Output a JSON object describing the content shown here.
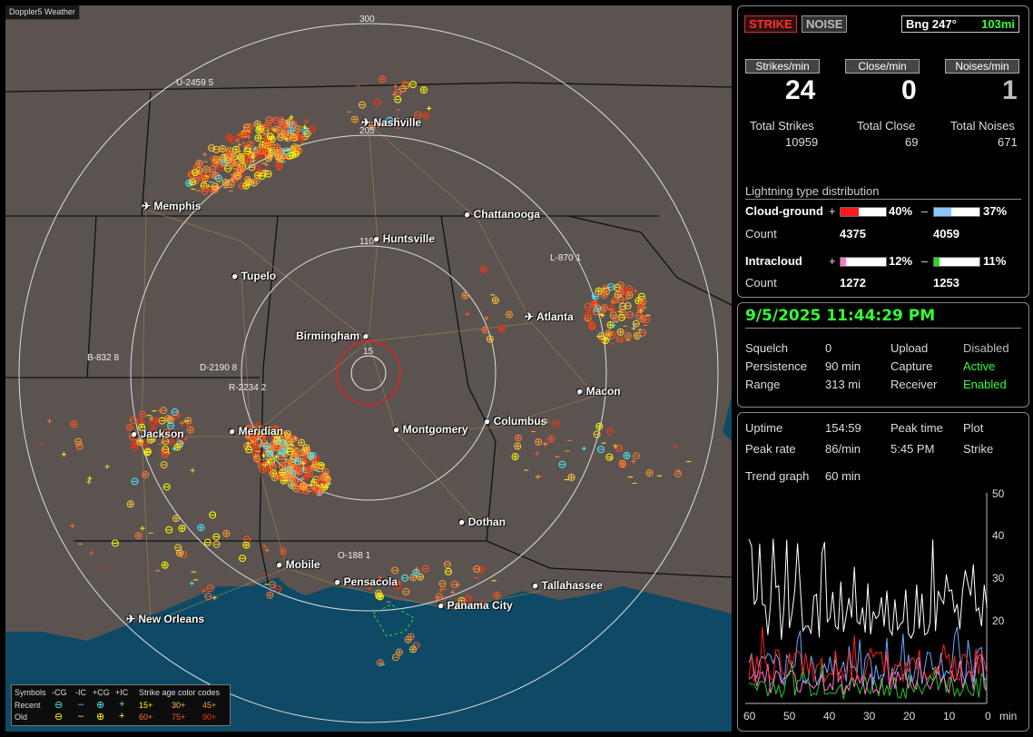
{
  "app_title": "Doppler5 Weather",
  "map": {
    "ring_labels": [
      "300",
      "205",
      "110",
      "15"
    ],
    "cities": [
      "Nashville",
      "Memphis",
      "Chattanooga",
      "Huntsville",
      "Tupelo",
      "Atlanta",
      "Birmingham",
      "Jackson",
      "Meridian",
      "Montgomery",
      "Columbus",
      "Macon",
      "Dothan",
      "Mobile",
      "Pensacola",
      "Tallahassee",
      "Panama City",
      "New Orleans"
    ],
    "storm_markers": [
      "U-2459 5",
      "L-870 1",
      "B-832 8",
      "D-2190 8",
      "R-2234 2",
      "O-188 1"
    ]
  },
  "legend": {
    "symbols_label": "Symbols",
    "headers": [
      "-CG",
      "-IC",
      "+CG",
      "+IC"
    ],
    "recent_label": "Recent",
    "old_label": "Old",
    "age_title": "Strike age color codes",
    "recent_ages": [
      "15+",
      "30+",
      "45+"
    ],
    "old_ages": [
      "60+",
      "75+",
      "90+"
    ],
    "age_colors": [
      "#ffff00",
      "#ffcc33",
      "#ff9933",
      "#ff7733",
      "#ff5522",
      "#ff3311"
    ]
  },
  "panel1": {
    "strike_btn": "STRIKE",
    "noise_btn": "NOISE",
    "bearing": "Bng 247°",
    "distance": "103mi",
    "strikes_min_label": "Strikes/min",
    "close_min_label": "Close/min",
    "noises_min_label": "Noises/min",
    "strikes_min": "24",
    "close_min": "0",
    "noises_min": "1",
    "total_strikes_label": "Total Strikes",
    "total_close_label": "Total Close",
    "total_noises_label": "Total Noises",
    "total_strikes": "10959",
    "total_close": "69",
    "total_noises": "671",
    "dist_title": "Lightning type distribution",
    "cg_label": "Cloud-ground",
    "ic_label": "Intracloud",
    "count_label": "Count",
    "plus": "+",
    "minus": "–",
    "cg_pos_pct": "40%",
    "cg_neg_pct": "37%",
    "cg_pos_count": "4375",
    "cg_neg_count": "4059",
    "ic_pos_pct": "12%",
    "ic_neg_pct": "11%",
    "ic_pos_count": "1272",
    "ic_neg_count": "1253",
    "bars": {
      "cg_pos": 0.4,
      "cg_neg": 0.37,
      "ic_pos": 0.12,
      "ic_neg": 0.11
    },
    "colors": {
      "cg_pos": "#ff1a1a",
      "cg_neg": "#88c8ff",
      "ic_pos": "#ff77cc",
      "ic_neg": "#22dd22"
    }
  },
  "panel2": {
    "datetime": "9/5/2025 11:44:29 PM",
    "squelch_label": "Squelch",
    "squelch": "0",
    "upload_label": "Upload",
    "upload": "Disabled",
    "persistence_label": "Persistence",
    "persistence": "90 min",
    "capture_label": "Capture",
    "capture": "Active",
    "range_label": "Range",
    "range": "313 mi",
    "receiver_label": "Receiver",
    "receiver": "Enabled"
  },
  "panel3": {
    "uptime_label": "Uptime",
    "uptime": "154:59",
    "peak_time_label": "Peak time",
    "plot_label": "Plot",
    "peak_rate_label": "Peak rate",
    "peak_rate": "86/min",
    "peak_time": "5:45 PM",
    "plot_value": "Strike",
    "trend_label": "Trend graph",
    "trend_value": "60 min",
    "y_ticks": [
      "50",
      "40",
      "30",
      "20"
    ],
    "x_ticks": [
      "60",
      "50",
      "40",
      "30",
      "20",
      "10",
      "0"
    ],
    "x_unit": "min"
  }
}
